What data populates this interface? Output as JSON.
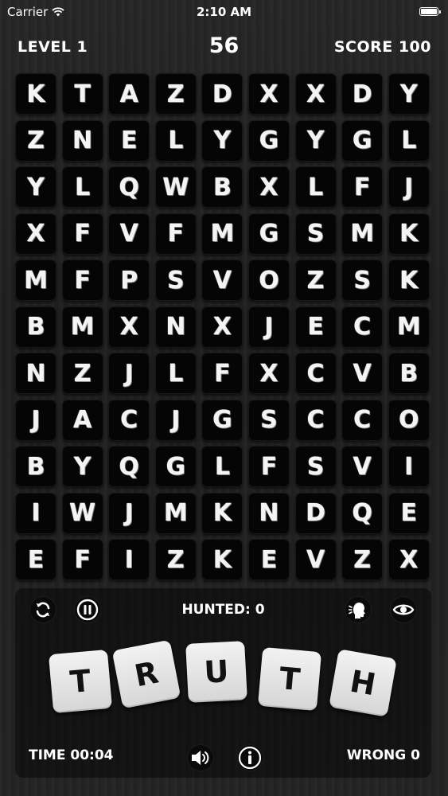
{
  "status_bar": {
    "carrier": "Carrier",
    "time": "2:10 AM"
  },
  "header": {
    "level": "LEVEL 1",
    "countdown": "56",
    "score": "SCORE 100"
  },
  "grid": [
    [
      "K",
      "T",
      "A",
      "Z",
      "D",
      "X",
      "X",
      "D",
      "Y"
    ],
    [
      "Z",
      "N",
      "E",
      "L",
      "Y",
      "G",
      "Y",
      "G",
      "L"
    ],
    [
      "Y",
      "L",
      "Q",
      "W",
      "B",
      "X",
      "L",
      "F",
      "J"
    ],
    [
      "X",
      "F",
      "V",
      "F",
      "M",
      "G",
      "S",
      "M",
      "K"
    ],
    [
      "M",
      "F",
      "P",
      "S",
      "V",
      "O",
      "Z",
      "S",
      "K"
    ],
    [
      "B",
      "M",
      "X",
      "N",
      "X",
      "J",
      "E",
      "C",
      "M"
    ],
    [
      "N",
      "Z",
      "J",
      "L",
      "F",
      "X",
      "C",
      "V",
      "B"
    ],
    [
      "J",
      "A",
      "C",
      "J",
      "G",
      "S",
      "C",
      "C",
      "O"
    ],
    [
      "B",
      "Y",
      "Q",
      "G",
      "L",
      "F",
      "S",
      "V",
      "I"
    ],
    [
      "I",
      "W",
      "J",
      "M",
      "K",
      "N",
      "D",
      "Q",
      "E"
    ],
    [
      "E",
      "F",
      "I",
      "Z",
      "K",
      "E",
      "V",
      "Z",
      "X"
    ]
  ],
  "panel": {
    "hunted": "HUNTED: 0",
    "target_word": [
      "T",
      "R",
      "U",
      "T",
      "H"
    ],
    "time": "TIME 00:04",
    "wrong": "WRONG 0"
  },
  "icons": {
    "refresh": "refresh-icon",
    "pause": "pause-icon",
    "hint": "speaking-head-icon",
    "reveal": "eye-icon",
    "sound": "speaker-icon",
    "info": "info-icon"
  },
  "colors": {
    "tile_dark": "#050505",
    "tile_light": "#e6e6e6",
    "text": "#ffffff"
  }
}
